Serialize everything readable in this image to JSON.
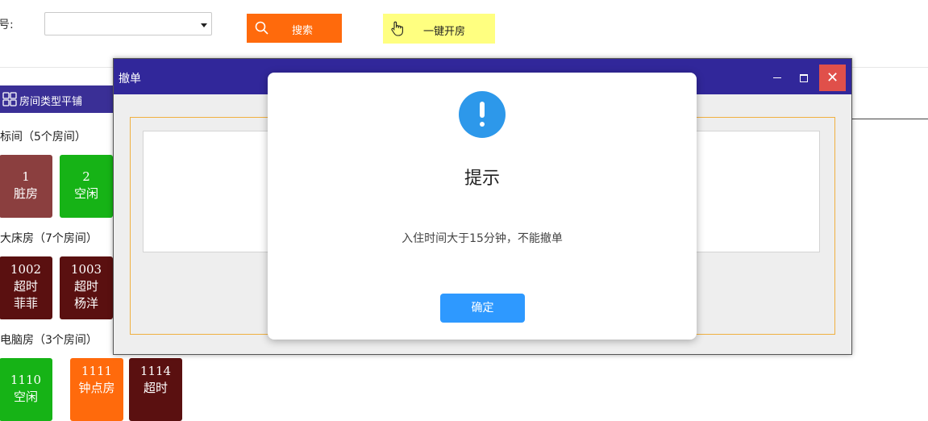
{
  "toolbar": {
    "room_no_label": "号:",
    "room_select_value": "",
    "search_label": "搜索",
    "open_room_label": "一键开房"
  },
  "tabs": {
    "tile_label": "房间类型平铺"
  },
  "groups": [
    {
      "title": "标间（5个房间）",
      "rooms": [
        {
          "number": "1",
          "status": "脏房",
          "guest": "",
          "color": "#8b3f3f"
        },
        {
          "number": "2",
          "status": "空闲",
          "guest": "",
          "color": "#16b316"
        }
      ]
    },
    {
      "title": "大床房（7个房间）",
      "rooms": [
        {
          "number": "1002",
          "status": "超时",
          "guest": "菲菲",
          "color": "#5a1010"
        },
        {
          "number": "1003",
          "status": "超时",
          "guest": "杨洋",
          "color": "#5a1010"
        }
      ]
    },
    {
      "title": "电脑房（3个房间）",
      "rooms": [
        {
          "number": "1110",
          "status": "空闲",
          "guest": "",
          "color": "#16b316"
        },
        {
          "number": "1111",
          "status": "钟点房",
          "guest": "",
          "color": "#ff6a0c"
        },
        {
          "number": "1114",
          "status": "超时",
          "guest": "",
          "color": "#5a1010"
        }
      ]
    }
  ],
  "window": {
    "title": "撤单",
    "close_glyph": "✕"
  },
  "dialog": {
    "title": "提示",
    "message": "入住时间大于15分钟，不能撤单",
    "ok_label": "确定"
  },
  "colors": {
    "accent": "#31279a",
    "search": "#ff6a0c",
    "open": "#ffff80",
    "ok": "#2e99ff",
    "close": "#e0504a"
  }
}
